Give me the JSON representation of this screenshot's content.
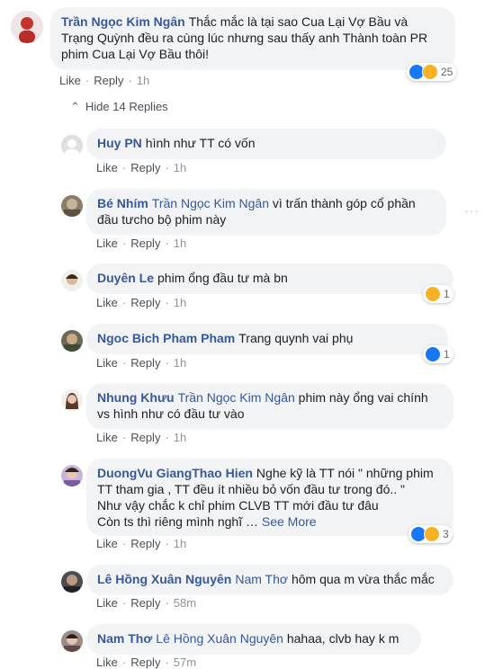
{
  "main_comment": {
    "author": "Trần Ngọc Kim Ngân",
    "text_lines": [
      "Thắc mắc là tại sao Cua Lại Vợ Bầu và",
      "Trạng Quỳnh đều ra cùng lúc nhưng sau thấy anh Thành toàn PR",
      "phim Cua Lại Vợ Bầu thôi!"
    ],
    "reaction_count": "25",
    "reactions": [
      "like-icon",
      "haha-icon"
    ],
    "actions": {
      "like": "Like",
      "reply": "Reply",
      "time": "1h"
    }
  },
  "hide_replies": {
    "arrow": "⌃",
    "label": "Hide 14 Replies"
  },
  "more_options": "···",
  "replies": [
    {
      "author": "Huy PN",
      "mention": "",
      "lines": [
        "hình như TT có vốn"
      ],
      "like": "Like",
      "reply": "Reply",
      "time": "1h",
      "reaction_count": "",
      "reactions": []
    },
    {
      "author": "Bé Nhím",
      "mention": "Trần Ngọc Kim Ngân",
      "lines": [
        "vì trấn thành góp cổ phần",
        "đầu tưcho bộ phim này"
      ],
      "like": "Like",
      "reply": "Reply",
      "time": "1h",
      "reaction_count": "",
      "reactions": []
    },
    {
      "author": "Duyên Le",
      "mention": "",
      "lines": [
        "phim ổng đầu tư mà bn"
      ],
      "like": "Like",
      "reply": "Reply",
      "time": "1h",
      "reaction_count": "1",
      "reactions": [
        "haha-icon"
      ]
    },
    {
      "author": "Ngoc Bich Pham Pham",
      "mention": "",
      "lines": [
        "Trang quynh vai phụ"
      ],
      "like": "Like",
      "reply": "Reply",
      "time": "1h",
      "reaction_count": "1",
      "reactions": [
        "like-icon"
      ]
    },
    {
      "author": "Nhung Khưu",
      "mention": "Trần Ngọc Kim Ngân",
      "lines": [
        "phim này ổng vai chính",
        "vs hình như có đầu tư vào"
      ],
      "like": "Like",
      "reply": "Reply",
      "time": "1h",
      "reaction_count": "",
      "reactions": []
    },
    {
      "author": "DuongVu GiangThao Hien",
      "mention": "",
      "lines": [
        "Nghe kỹ là TT nói \" những phim",
        "TT tham gia , TT đều ít nhiều bỏ vốn đầu tư trong đó.. \"",
        "Như vậy chắc k chỉ phim CLVB TT mới đầu tư đâu",
        "Còn ts thì riêng mình nghĩ …"
      ],
      "see_more": "See More",
      "like": "Like",
      "reply": "Reply",
      "time": "1h",
      "reaction_count": "3",
      "reactions": [
        "like-icon",
        "wow-icon"
      ]
    },
    {
      "author": "Lê Hồng Xuân Nguyên",
      "mention": "Nam Thơ",
      "lines": [
        "hôm qua m vừa thắc mắc"
      ],
      "like": "Like",
      "reply": "Reply",
      "time": "58m",
      "reaction_count": "",
      "reactions": []
    },
    {
      "author": "Nam Thơ",
      "mention": "Lê Hồng Xuân Nguyên",
      "lines": [
        "hahaa, clvb hay k m"
      ],
      "like": "Like",
      "reply": "Reply",
      "time": "57m",
      "reaction_count": "",
      "reactions": []
    }
  ]
}
